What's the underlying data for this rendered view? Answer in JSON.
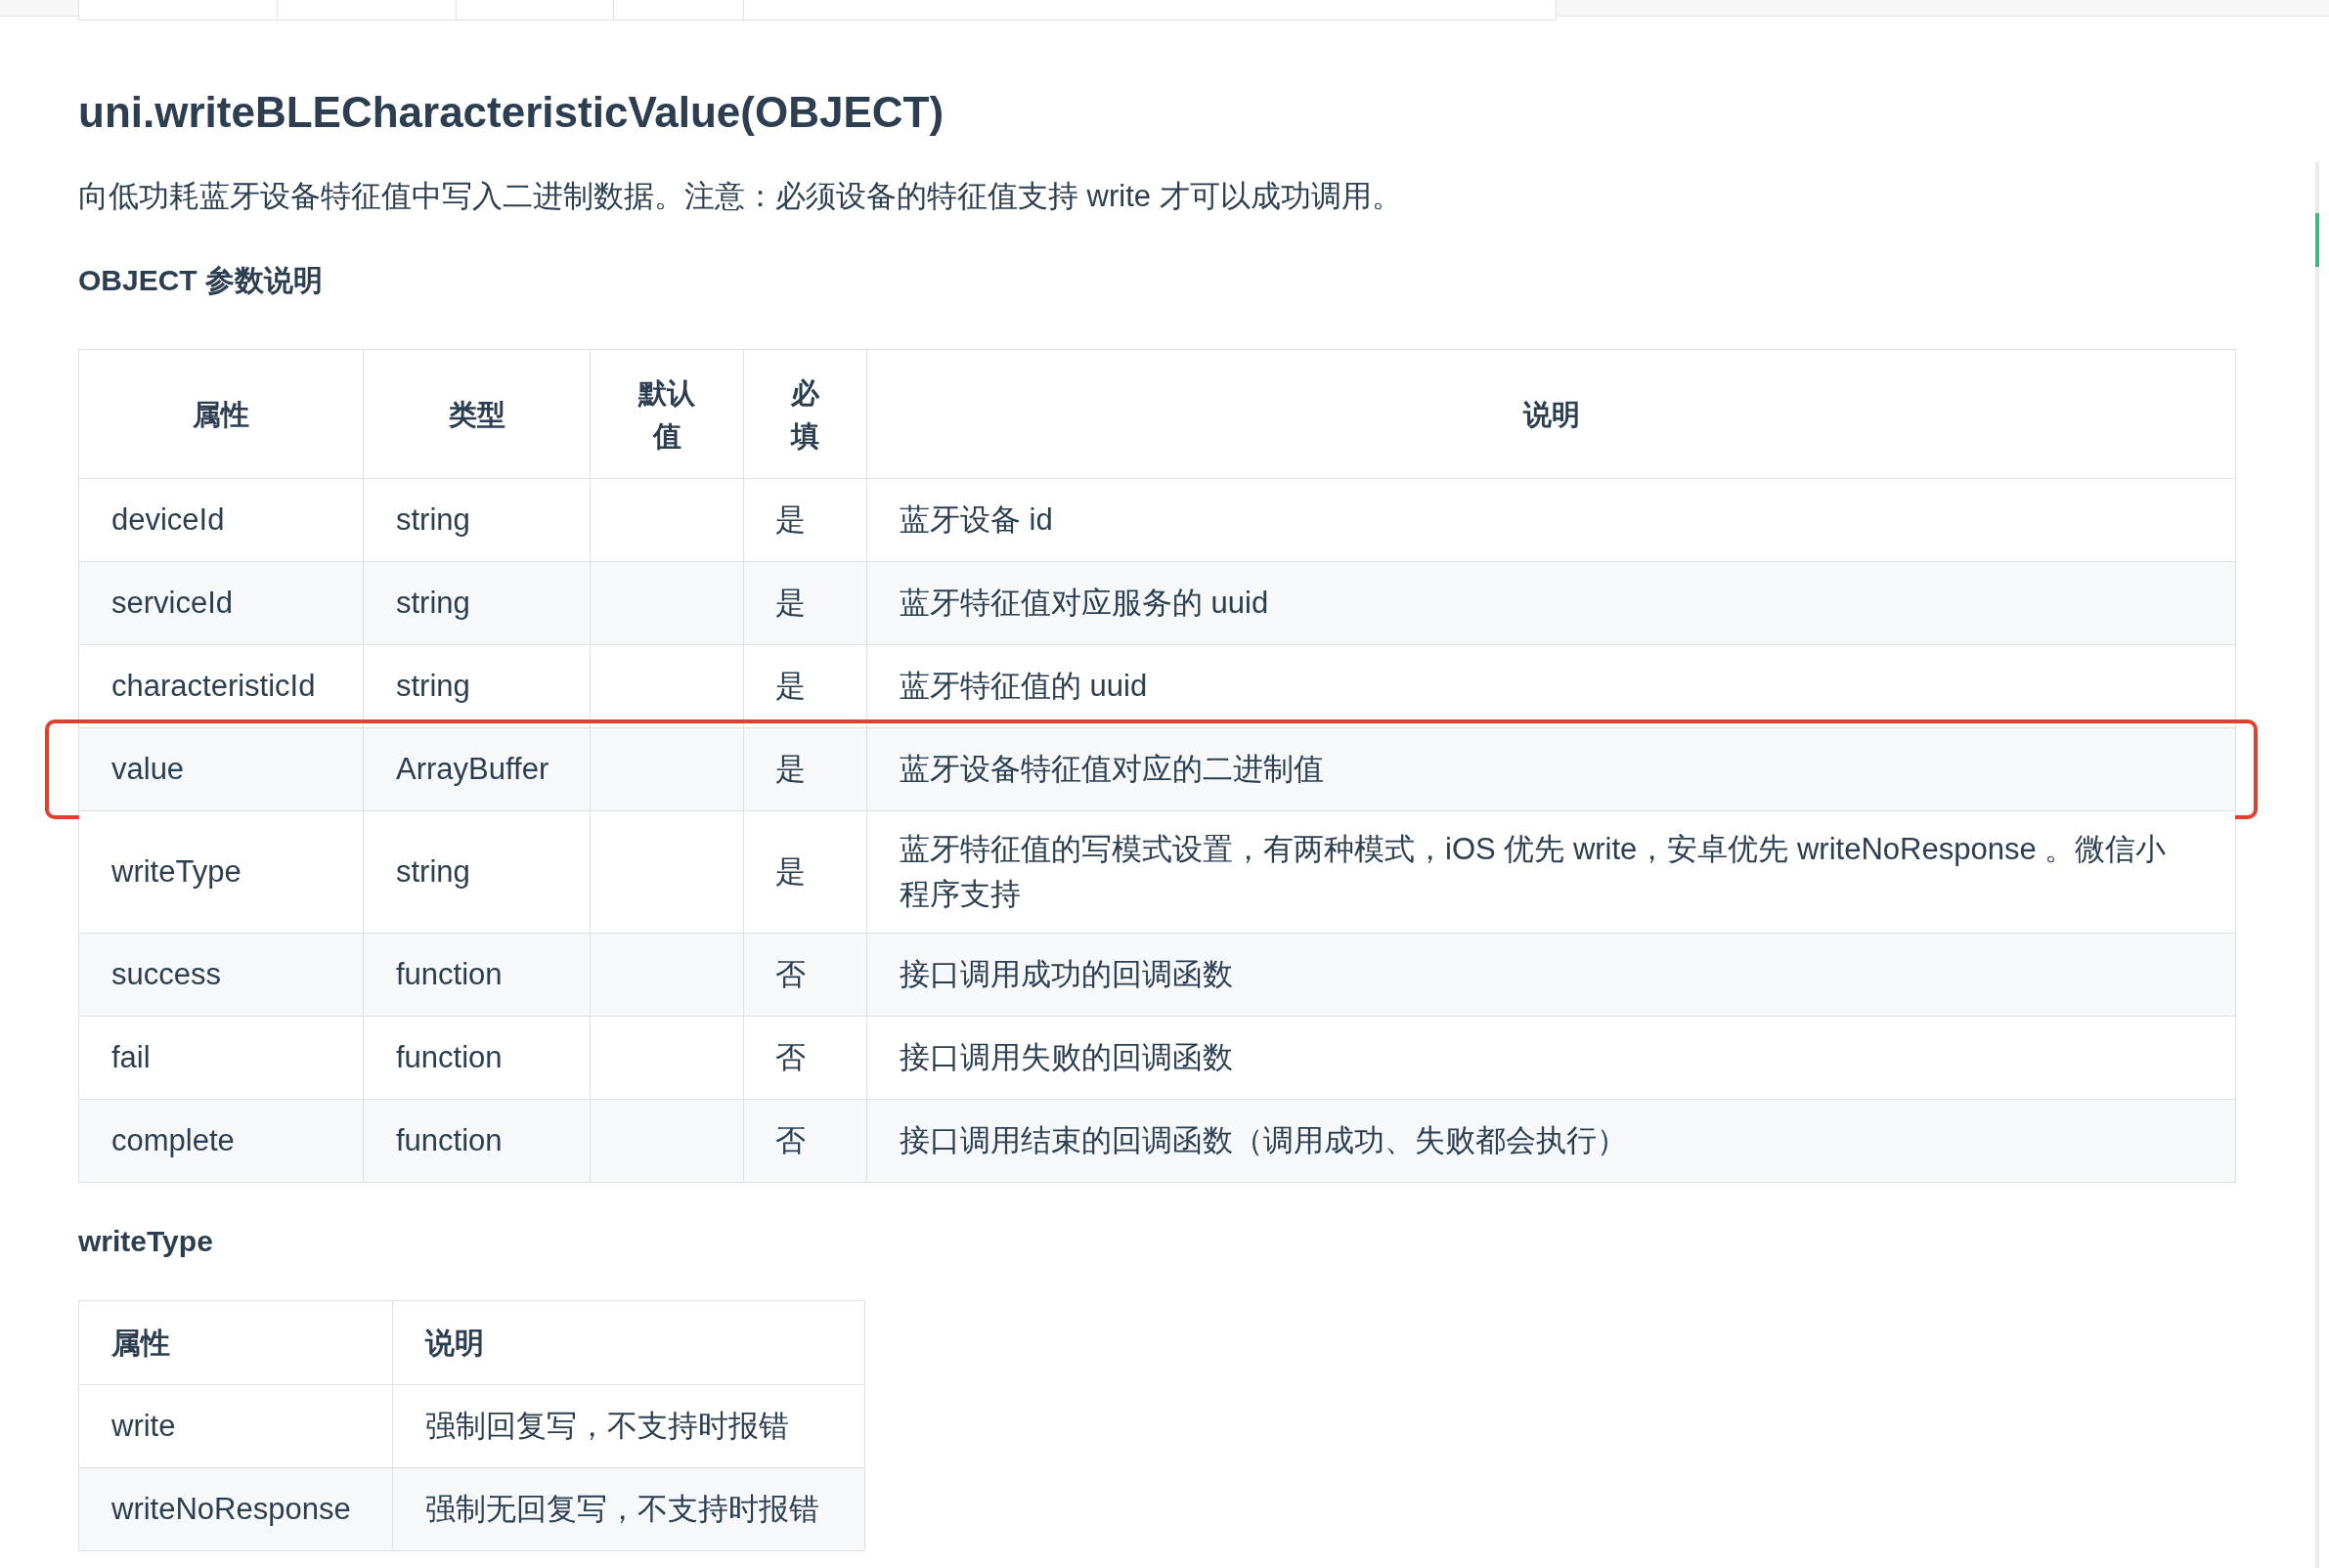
{
  "title": "uni.writeBLECharacteristicValue(OBJECT)",
  "intro": "向低功耗蓝牙设备特征值中写入二进制数据。注意：必须设备的特征值支持 write 才可以成功调用。",
  "params_heading": "OBJECT 参数说明",
  "params_table": {
    "columns": [
      "属性",
      "类型",
      "默认值",
      "必填",
      "说明"
    ],
    "rows": [
      {
        "cells": [
          "deviceId",
          "string",
          "",
          "是",
          "蓝牙设备 id"
        ],
        "highlighted": false
      },
      {
        "cells": [
          "serviceId",
          "string",
          "",
          "是",
          "蓝牙特征值对应服务的 uuid"
        ],
        "highlighted": false
      },
      {
        "cells": [
          "characteristicId",
          "string",
          "",
          "是",
          "蓝牙特征值的 uuid"
        ],
        "highlighted": false
      },
      {
        "cells": [
          "value",
          "ArrayBuffer",
          "",
          "是",
          "蓝牙设备特征值对应的二进制值"
        ],
        "highlighted": true
      },
      {
        "cells": [
          "writeType",
          "string",
          "",
          "是",
          "蓝牙特征值的写模式设置，有两种模式，iOS 优先 write，安卓优先 writeNoResponse 。微信小程序支持"
        ],
        "highlighted": false
      },
      {
        "cells": [
          "success",
          "function",
          "",
          "否",
          "接口调用成功的回调函数"
        ],
        "highlighted": false
      },
      {
        "cells": [
          "fail",
          "function",
          "",
          "否",
          "接口调用失败的回调函数"
        ],
        "highlighted": false
      },
      {
        "cells": [
          "complete",
          "function",
          "",
          "否",
          "接口调用结束的回调函数（调用成功、失败都会执行）"
        ],
        "highlighted": false
      }
    ]
  },
  "writetype_heading": "writeType",
  "writetype_table": {
    "columns": [
      "属性",
      "说明"
    ],
    "rows": [
      {
        "cells": [
          "write",
          "强制回复写，不支持时报错"
        ]
      },
      {
        "cells": [
          "writeNoResponse",
          "强制无回复写，不支持时报错"
        ]
      }
    ]
  }
}
